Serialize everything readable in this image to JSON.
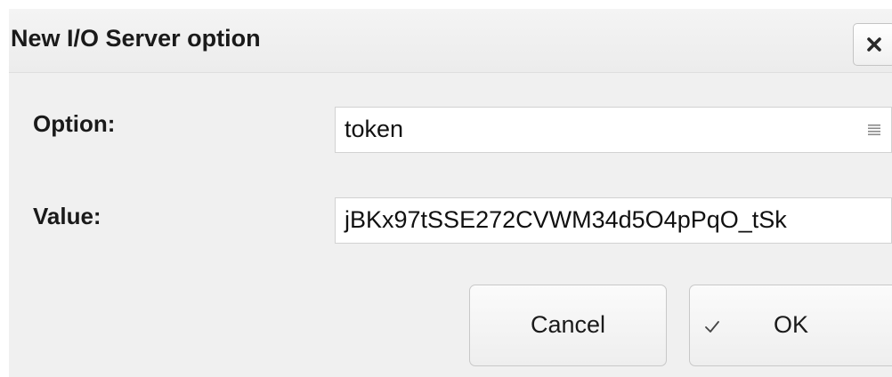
{
  "dialog": {
    "title": "New I/O Server option"
  },
  "form": {
    "option": {
      "label": "Option:",
      "value": "token"
    },
    "value": {
      "label": "Value:",
      "value": "jBKx97tSSE272CVWM34d5O4pPqO_tSk"
    }
  },
  "buttons": {
    "cancel_label": "Cancel",
    "ok_label": "OK"
  },
  "icons": {
    "close": "close-icon",
    "menu": "menu-lines-icon",
    "check": "check-icon"
  },
  "colors": {
    "dialog_bg": "#f0f0f0",
    "field_bg": "#ffffff",
    "text": "#1a1a1a"
  }
}
